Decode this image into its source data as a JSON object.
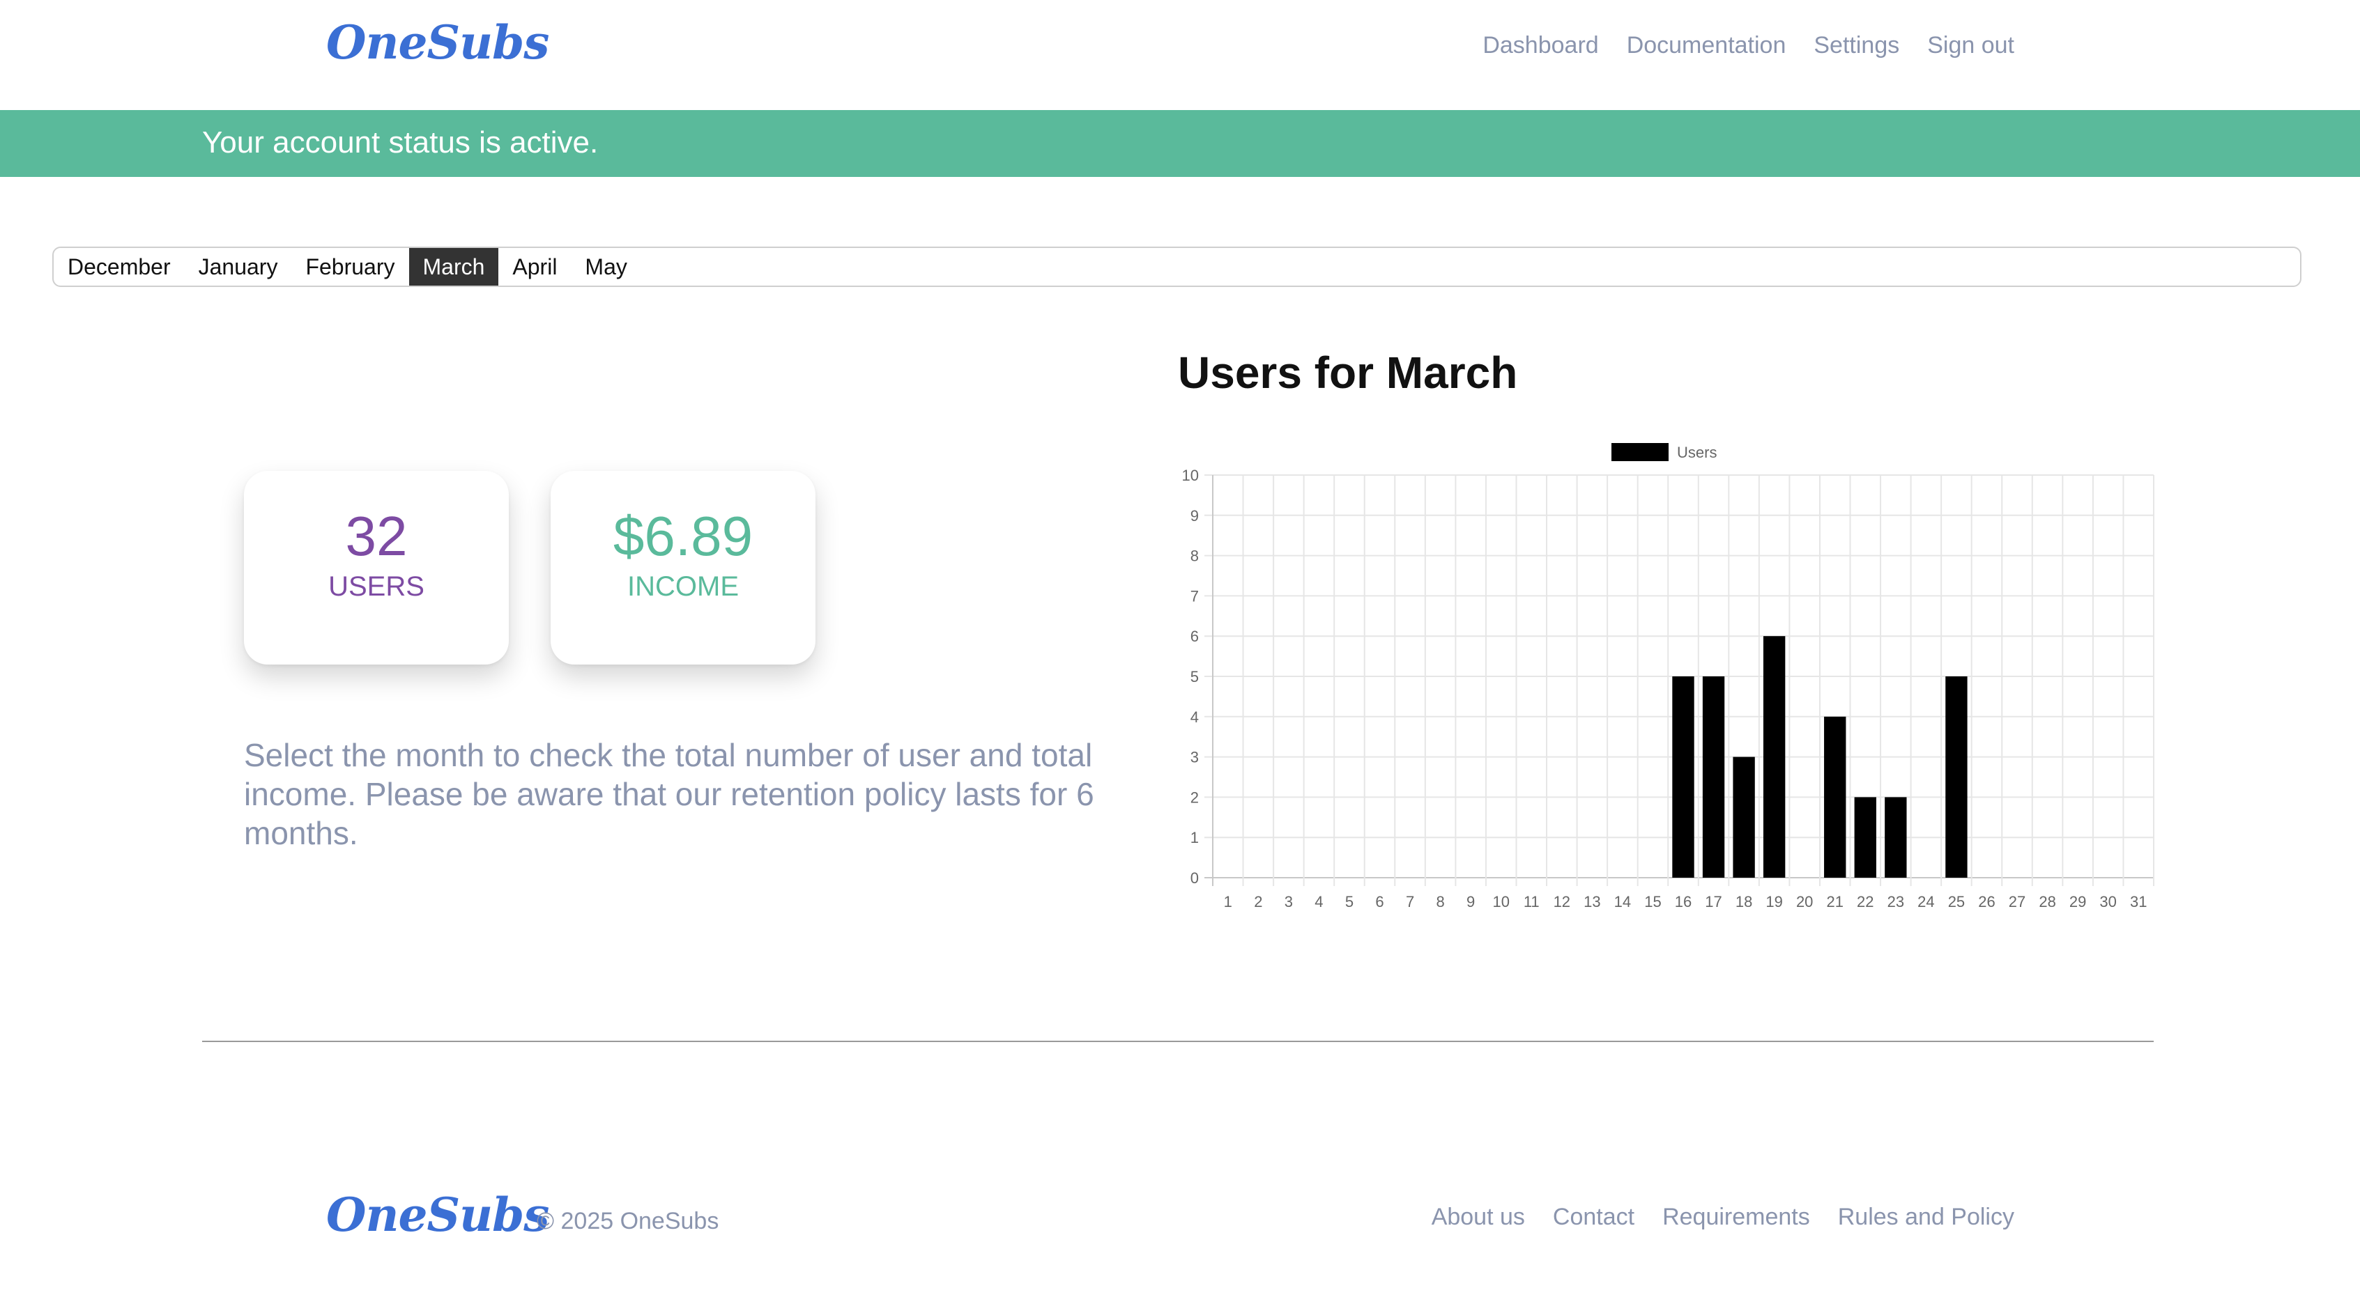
{
  "header": {
    "logo": "OneSubs",
    "nav": [
      "Dashboard",
      "Documentation",
      "Settings",
      "Sign out"
    ]
  },
  "status_banner": {
    "text": "Your account status is active.",
    "color": "#5aba9b"
  },
  "months": {
    "items": [
      "December",
      "January",
      "February",
      "March",
      "April",
      "May"
    ],
    "selected": "March"
  },
  "stats": {
    "users": {
      "value": "32",
      "label": "USERS",
      "color": "#7d4ba3"
    },
    "income": {
      "value": "$6.89",
      "label": "INCOME",
      "color": "#5aba9b"
    }
  },
  "description": "Select the month to check the total number of user and total income. Please be aware that our retention policy lasts for 6 months.",
  "chart": {
    "title": "Users for March"
  },
  "chart_data": {
    "type": "bar",
    "title": "Users for March",
    "categories": [
      "1",
      "2",
      "3",
      "4",
      "5",
      "6",
      "7",
      "8",
      "9",
      "10",
      "11",
      "12",
      "13",
      "14",
      "15",
      "16",
      "17",
      "18",
      "19",
      "20",
      "21",
      "22",
      "23",
      "24",
      "25",
      "26",
      "27",
      "28",
      "29",
      "30",
      "31"
    ],
    "series": [
      {
        "name": "Users",
        "color": "#000000",
        "values": [
          0,
          0,
          0,
          0,
          0,
          0,
          0,
          0,
          0,
          0,
          0,
          0,
          0,
          0,
          0,
          5,
          5,
          3,
          6,
          0,
          4,
          2,
          2,
          0,
          5,
          0,
          0,
          0,
          0,
          0,
          0
        ]
      }
    ],
    "ylim": [
      0,
      10
    ],
    "yticks": [
      "0",
      "1",
      "2",
      "3",
      "4",
      "5",
      "6",
      "7",
      "8",
      "9",
      "10"
    ],
    "grid": true,
    "legend": "top-center"
  },
  "footer": {
    "logo": "OneSubs",
    "copyright": "© 2025 OneSubs",
    "links": [
      "About us",
      "Contact",
      "Requirements",
      "Rules and Policy"
    ]
  }
}
